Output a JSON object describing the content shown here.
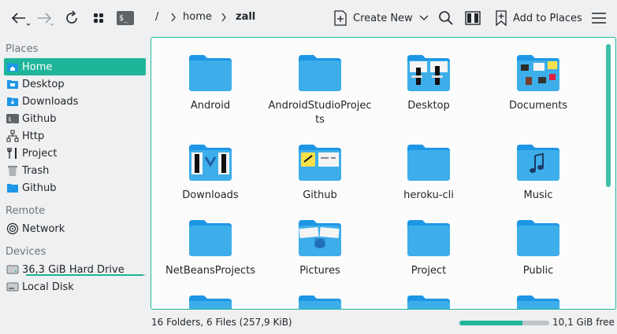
{
  "toolbar": {
    "breadcrumb": [
      "/",
      "home",
      "zall"
    ],
    "create_new_label": "Create New",
    "add_places_label": "Add to Places"
  },
  "sidebar": {
    "places_title": "Places",
    "places": [
      {
        "label": "Home",
        "icon": "home-folder-icon",
        "active": true
      },
      {
        "label": "Desktop",
        "icon": "desktop-folder-icon"
      },
      {
        "label": "Downloads",
        "icon": "downloads-folder-icon"
      },
      {
        "label": "Github",
        "icon": "terminal-icon"
      },
      {
        "label": "Http",
        "icon": "network-tree-icon"
      },
      {
        "label": "Project",
        "icon": "tools-icon"
      },
      {
        "label": "Trash",
        "icon": "trash-icon"
      },
      {
        "label": "Github",
        "icon": "folder-icon"
      }
    ],
    "remote_title": "Remote",
    "remote": [
      {
        "label": "Network",
        "icon": "network-icon"
      }
    ],
    "devices_title": "Devices",
    "devices": [
      {
        "label": "36,3 GiB Hard Drive",
        "icon": "hard-drive-icon",
        "usage": 0.98
      },
      {
        "label": "Local Disk",
        "icon": "local-disk-icon"
      }
    ]
  },
  "files": [
    {
      "name": "Android",
      "icon": "folder-icon"
    },
    {
      "name": "AndroidStudioProjects",
      "icon": "folder-icon"
    },
    {
      "name": "Desktop",
      "icon": "desktop-folder-preview"
    },
    {
      "name": "Documents",
      "icon": "documents-folder-preview"
    },
    {
      "name": "Downloads",
      "icon": "downloads-folder-preview"
    },
    {
      "name": "Github",
      "icon": "github-folder-preview"
    },
    {
      "name": "heroku-cli",
      "icon": "folder-icon"
    },
    {
      "name": "Music",
      "icon": "music-folder-icon"
    },
    {
      "name": "NetBeansProjects",
      "icon": "folder-icon"
    },
    {
      "name": "Pictures",
      "icon": "pictures-folder-preview"
    },
    {
      "name": "Project",
      "icon": "folder-icon"
    },
    {
      "name": "Public",
      "icon": "folder-icon"
    }
  ],
  "status": {
    "summary": "16 Folders, 6 Files (257,9 KiB)",
    "free": "10,1 GiB free",
    "used_fraction": 0.7
  },
  "colors": {
    "accent": "#1fb59a",
    "folder": "#1e96e6"
  }
}
